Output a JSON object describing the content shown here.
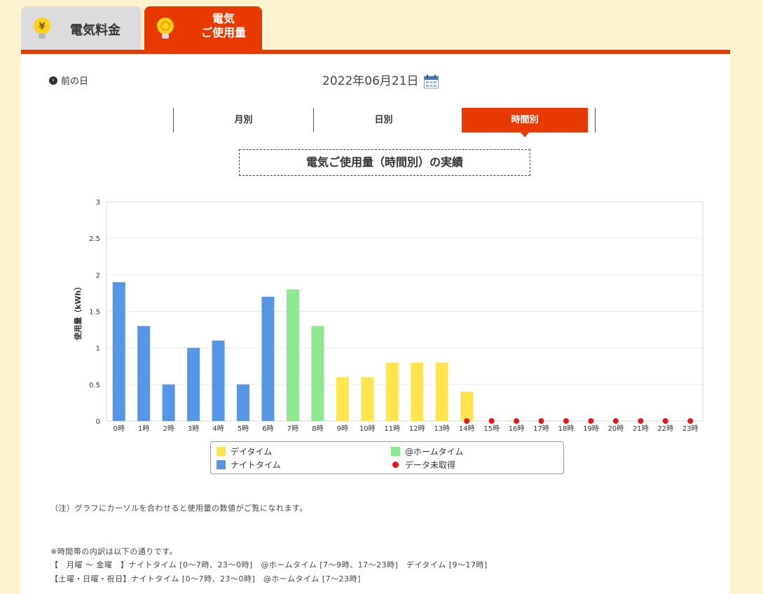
{
  "tabs": {
    "fee": {
      "label": "電気料金",
      "icon": "yen-bulb-icon"
    },
    "usage": {
      "label_line1": "電気",
      "label_line2": "ご使用量",
      "icon": "lightbulb-icon"
    }
  },
  "nav": {
    "prev_day_label": "前の日",
    "date": "2022年06月21日",
    "calendar_icon": "calendar-icon"
  },
  "period_tabs": {
    "monthly": "月別",
    "daily": "日別",
    "hourly": "時間別"
  },
  "chart_title": "電気ご使用量（時間別）の実績",
  "colors": {
    "accent": "#e83a00",
    "day": "#ffe44d",
    "home": "#8ee88e",
    "night": "#5596e6",
    "missing": "#e8141c"
  },
  "chart_data": {
    "type": "bar",
    "ylabel": "使用量（kWh）",
    "ylim": [
      0,
      3
    ],
    "yticks": [
      "0",
      "0.5",
      "1",
      "1.5",
      "2",
      "2.5",
      "3"
    ],
    "categories": [
      "0時",
      "1時",
      "2時",
      "3時",
      "4時",
      "5時",
      "6時",
      "7時",
      "8時",
      "9時",
      "10時",
      "11時",
      "12時",
      "13時",
      "14時",
      "15時",
      "16時",
      "17時",
      "18時",
      "19時",
      "20時",
      "21時",
      "22時",
      "23時"
    ],
    "series": [
      {
        "name": "デイタイム",
        "values": [
          null,
          null,
          null,
          null,
          null,
          null,
          null,
          null,
          null,
          0.6,
          0.6,
          0.8,
          0.8,
          0.8,
          0.4,
          null,
          null,
          null,
          null,
          null,
          null,
          null,
          null,
          null
        ]
      },
      {
        "name": "@ホームタイム",
        "values": [
          null,
          null,
          null,
          null,
          null,
          null,
          null,
          1.8,
          1.3,
          null,
          null,
          null,
          null,
          null,
          null,
          null,
          null,
          null,
          null,
          null,
          null,
          null,
          null,
          null
        ]
      },
      {
        "name": "ナイトタイム",
        "values": [
          1.9,
          1.3,
          0.5,
          1.0,
          1.1,
          0.5,
          1.7,
          null,
          null,
          null,
          null,
          null,
          null,
          null,
          null,
          null,
          null,
          null,
          null,
          null,
          null,
          null,
          null,
          null
        ]
      },
      {
        "name": "データ未取得",
        "points": [
          14,
          15,
          16,
          17,
          18,
          19,
          20,
          21,
          22,
          23
        ]
      }
    ],
    "grid": true
  },
  "legend": {
    "day": "デイタイム",
    "home": "@ホームタイム",
    "night": "ナイトタイム",
    "missing": "データ未取得"
  },
  "notes": {
    "cursor_note": "（注）グラフにカーソルを合わせると使用量の数値がご覧になれます。",
    "breakdown_title": "※時間帯の内訳は以下の通りです。",
    "weekday": "【　月曜 〜 金曜　】ナイトタイム [0〜7時、23〜0時]　@ホームタイム [7〜9時、17〜23時]　デイタイム [9〜17時]",
    "weekend": "【土曜・日曜・祝日】ナイトタイム [0〜7時、23〜0時]　@ホームタイム [7〜23時]"
  }
}
